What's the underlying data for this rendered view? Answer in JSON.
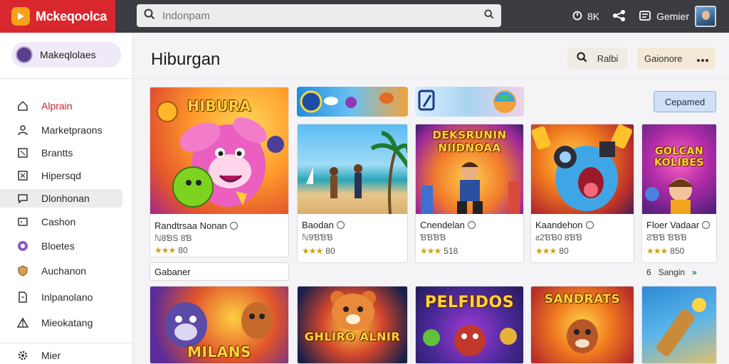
{
  "header": {
    "app_name": "Mckeqoolca",
    "search_placeholder": "Indonpam",
    "stat_label": "8K",
    "user_name": "Gemier"
  },
  "sidebar": {
    "profile_label": "Makeqlolaes",
    "items": [
      {
        "label": "Alprain",
        "icon": "home-icon",
        "state": "active"
      },
      {
        "label": "Marketpraons",
        "icon": "person-icon",
        "state": ""
      },
      {
        "label": "Brantts",
        "icon": "box-icon",
        "state": ""
      },
      {
        "label": "Hipersqd",
        "icon": "box-icon",
        "state": ""
      },
      {
        "label": "Dlonhonan",
        "icon": "chat-icon",
        "state": "hover"
      },
      {
        "label": "Cashon",
        "icon": "card-icon",
        "state": ""
      },
      {
        "label": "Bloetes",
        "icon": "circle-icon",
        "state": ""
      },
      {
        "label": "Auchanon",
        "icon": "shield-icon",
        "state": ""
      },
      {
        "label": "Inlpanolano",
        "icon": "doc-icon",
        "state": ""
      },
      {
        "label": "Mieokatang",
        "icon": "tent-icon",
        "state": ""
      }
    ],
    "footer_label": "Mier"
  },
  "main": {
    "title": "Hiburgan",
    "search_button": "Ralbi",
    "category_button": "Gaionore",
    "compare_button": "Cepamed",
    "featured": {
      "art_text": "HIBURA",
      "name": "Randtrsaa Nonan",
      "sub": "ℕ8ƁS 8Ɓ",
      "stars": "★★★",
      "rating": "80"
    },
    "cards_row1": [
      {
        "art_text": "",
        "name": "Baodan",
        "sub": "ℕ9ƁƁƁ",
        "stars": "★★★",
        "rating": "80"
      },
      {
        "art_text": "DEKSRUNIN NIIDNOAA",
        "name": "Cnendelan",
        "sub": "ƁƁƁƁ",
        "stars": "★★★",
        "rating": "518"
      },
      {
        "art_text": "",
        "name": "Kaandehon",
        "sub": "ƨ2ƁƁ0 8ƁƁ",
        "stars": "★★★",
        "rating": "80"
      },
      {
        "art_text": "GOLCAN KOLIBES",
        "name": "Floer Vadaar",
        "sub": "ƧƁƁ ƁƁƁ",
        "stars": "★★★",
        "rating": "850"
      }
    ],
    "section_tab": "Gabaner",
    "pager": {
      "page": "6",
      "label": "Sangin",
      "arrows": "»"
    },
    "cards_row2": [
      {
        "art_text": "MILANS"
      },
      {
        "art_text": "GHLIRO ALNIR"
      },
      {
        "art_text": "PELFIDOS"
      },
      {
        "art_text": "SANDRATS"
      },
      {
        "art_text": ""
      }
    ]
  }
}
